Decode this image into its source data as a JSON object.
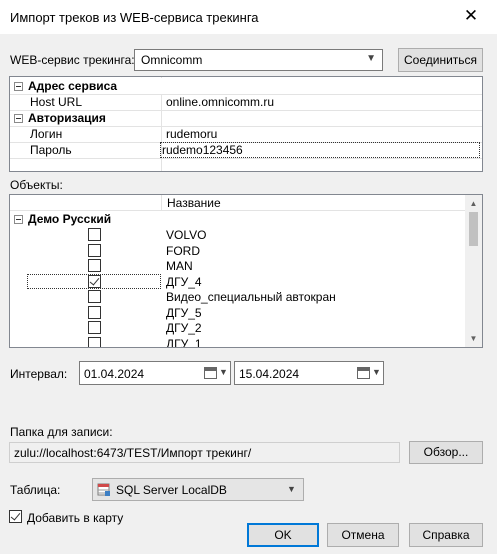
{
  "window": {
    "title": "Импорт треков из WEB-сервиса трекинга",
    "close_glyph": "✕"
  },
  "service": {
    "label": "WEB-сервис трекинга:",
    "selected": "Omnicomm",
    "connect_label": "Соединиться"
  },
  "props": {
    "groups": [
      {
        "name": "Адрес сервиса",
        "rows": [
          {
            "key": "Host URL",
            "value": "online.omnicomm.ru"
          }
        ]
      },
      {
        "name": "Авторизация",
        "rows": [
          {
            "key": "Логин",
            "value": "rudemoru"
          },
          {
            "key": "Пароль",
            "value": "rudemo123456"
          }
        ]
      }
    ]
  },
  "objects": {
    "label": "Объекты:",
    "column_name": "Название",
    "group": "Демо Русский",
    "items": [
      {
        "name": "VOLVO",
        "checked": false
      },
      {
        "name": "FORD",
        "checked": false
      },
      {
        "name": "MAN",
        "checked": false
      },
      {
        "name": "ДГУ_4",
        "checked": true
      },
      {
        "name": "Видео_специальный автокран",
        "checked": false
      },
      {
        "name": "ДГУ_5",
        "checked": false
      },
      {
        "name": "ДГУ_2",
        "checked": false
      },
      {
        "name": "ДГУ_1",
        "checked": false
      }
    ]
  },
  "interval": {
    "label": "Интервал:",
    "from": "01.04.2024",
    "to": "15.04.2024"
  },
  "folder": {
    "label": "Папка для записи:",
    "path": "zulu://localhost:6473/TEST/Импорт трекинг/",
    "browse_label": "Обзор..."
  },
  "table": {
    "label": "Таблица:",
    "selected": "SQL Server LocalDB"
  },
  "add_to_map": {
    "label": "Добавить в карту",
    "checked": true
  },
  "buttons": {
    "ok": "OK",
    "cancel": "Отмена",
    "help": "Справка"
  },
  "icons": {
    "close": "close-icon",
    "dropdown": "chevron-down-icon",
    "calendar": "calendar-icon",
    "db": "database-icon"
  }
}
